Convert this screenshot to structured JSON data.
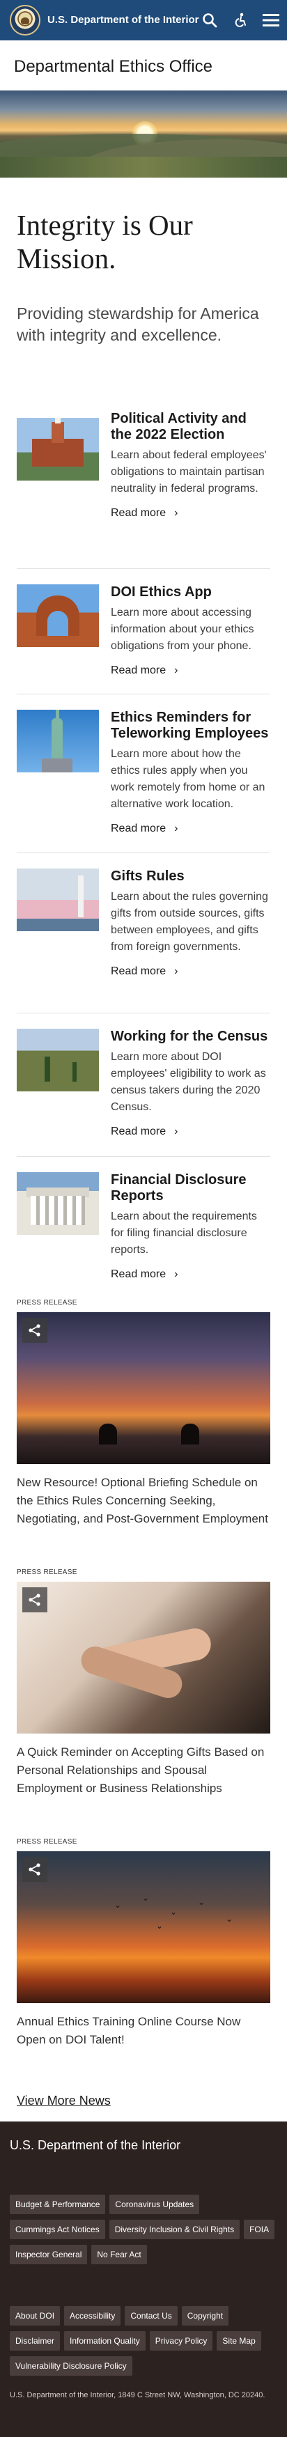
{
  "header": {
    "agency_name": "U.S. Department of the Interior",
    "icons": [
      "doi-seal",
      "search-icon",
      "accessibility-icon",
      "menu-icon"
    ]
  },
  "office_title": "Departmental Ethics Office",
  "intro": {
    "heading": "Integrity is Our Mission.",
    "text": "Providing stewardship for America with integrity and excellence."
  },
  "cards": [
    {
      "title": "Political Activity and the 2022 Election",
      "text": "Learn about federal employees' obligations to maintain partisan neutrality in federal programs.",
      "link": "Read more"
    },
    {
      "title": "DOI Ethics App",
      "text": "Learn more about accessing information about your ethics obligations from your phone.",
      "link": "Read more"
    },
    {
      "title": "Ethics Reminders for Teleworking Employees",
      "text": "Learn more about how the ethics rules apply when you work remotely from home or an alternative work location.",
      "link": "Read more"
    },
    {
      "title": "Gifts Rules",
      "text": "Learn about the rules governing gifts from outside sources, gifts between employees, and gifts from foreign governments.",
      "link": "Read more"
    },
    {
      "title": "Working for the Census",
      "text": "Learn more about DOI employees' eligibility to work as census takers during the 2020 Census.",
      "link": "Read more"
    },
    {
      "title": "Financial Disclosure Reports",
      "text": "Learn about the requirements for filing financial disclosure reports.",
      "link": "Read more"
    }
  ],
  "press": [
    {
      "label": "PRESS RELEASE",
      "title": "New Resource! Optional Briefing Schedule on the Ethics Rules Concerning Seeking, Negotiating, and Post-Government Employment"
    },
    {
      "label": "PRESS RELEASE",
      "title": "A Quick Reminder on Accepting Gifts Based on Personal Relationships and Spousal Employment or Business Relationships"
    },
    {
      "label": "PRESS RELEASE",
      "title": "Annual Ethics Training Online Course Now Open on DOI Talent!"
    }
  ],
  "view_more": "View More News",
  "footer": {
    "title": "U.S. Department of the Interior",
    "links_primary": [
      "Budget & Performance",
      "Coronavirus Updates",
      "Cummings Act Notices",
      "Diversity Inclusion & Civil Rights",
      "FOIA",
      "Inspector General",
      "No Fear Act"
    ],
    "links_secondary": [
      "About DOI",
      "Accessibility",
      "Contact Us",
      "Copyright",
      "Disclaimer",
      "Information Quality",
      "Privacy Policy",
      "Site Map",
      "Vulnerability Disclosure Policy"
    ],
    "address": "U.S. Department of the Interior, 1849 C Street NW, Washington, DC 20240."
  },
  "colors": {
    "header_bg": "#1e4b7a",
    "footer_bg": "#2c2220",
    "chip_bg": "#4a3e3c"
  }
}
